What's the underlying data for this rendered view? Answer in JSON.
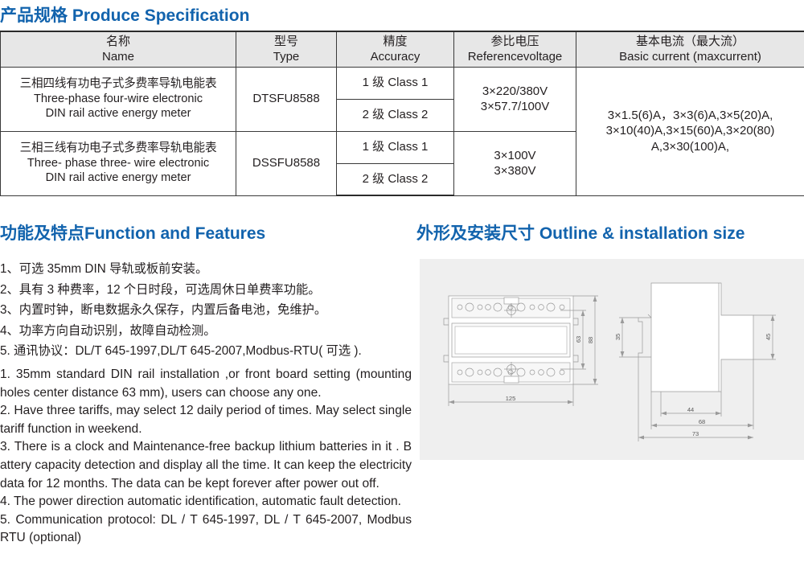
{
  "title": {
    "spec_cn": "产品规格",
    "spec_en": "Produce Specification"
  },
  "table": {
    "headers": [
      {
        "cn": "名称",
        "en": "Name"
      },
      {
        "cn": "型号",
        "en": "Type"
      },
      {
        "cn": "精度",
        "en": "Accuracy"
      },
      {
        "cn": "参比电压",
        "en": "Referencevoltage"
      },
      {
        "cn": "基本电流（最大流）",
        "en": "Basic current (maxcurrent)"
      }
    ],
    "rows": [
      {
        "name_cn": "三相四线有功电子式多费率导轨电能表",
        "name_en_1": "Three-phase four-wire electronic",
        "name_en_2": "DIN rail active energy meter",
        "type": "DTSFU8588",
        "accuracy_1": "1 级 Class 1",
        "accuracy_2": "2 级 Class 2",
        "voltage_1": "3×220/380V",
        "voltage_2": "3×57.7/100V"
      },
      {
        "name_cn": "三相三线有功电子式多费率导轨电能表",
        "name_en_1": "Three- phase three- wire electronic",
        "name_en_2": "DIN rail active energy meter",
        "type": "DSSFU8588",
        "accuracy_1": "1 级 Class 1",
        "accuracy_2": "2 级 Class 2",
        "voltage_1": "3×100V",
        "voltage_2": "3×380V"
      }
    ],
    "current_1": "3×1.5(6)A，3×3(6)A,3×5(20)A,",
    "current_2": "3×10(40)A,3×15(60)A,3×20(80)",
    "current_3": "A,3×30(100)A,"
  },
  "function_section": {
    "heading_cn": "功能及特点",
    "heading_en": "Function and Features",
    "items_cn": [
      "1、可选 35mm DIN 导轨或板前安装。",
      "2、具有 3 种费率，12 个日时段，可选周休日单费率功能。",
      "3、内置时钟，断电数据永久保存，内置后备电池，免维护。",
      "4、功率方向自动识别，故障自动检测。",
      "5. 通讯协议：DL/T 645-1997,DL/T 645-2007,Modbus-RTU( 可选 )."
    ],
    "items_en": [
      "1. 35mm standard DIN rail installation ,or front board setting (mounting holes center distance 63 mm), users can choose any one.",
      "2. Have three tariffs, may select 12 daily period of times. May select single tariff function in weekend.",
      "3. There is a clock and Maintenance-free backup lithium batteries in it . B attery capacity detection and display all the time. It can keep the electricity data for 12 months. The data can be kept forever after power out off.",
      "4. The power direction automatic identification, automatic fault detection.",
      "5. Communication protocol: DL / T 645-1997, DL / T 645-2007, Modbus RTU (optional)"
    ]
  },
  "outline_section": {
    "heading_cn": "外形及安装尺寸",
    "heading_en": "Outline & installation size",
    "front_view_dims": {
      "width": "125",
      "height_outer": "88",
      "height_inner": "63"
    },
    "side_view_dims": {
      "rail_height": "35",
      "body_height": "45",
      "depth_a": "44",
      "depth_b": "68",
      "depth_c": "73"
    }
  },
  "colors": {
    "heading_blue": "#1263ad",
    "table_header_bg": "#e7e7e7",
    "panel_bg": "#efefef",
    "text": "#231f20",
    "line": "#3a3a3a"
  }
}
